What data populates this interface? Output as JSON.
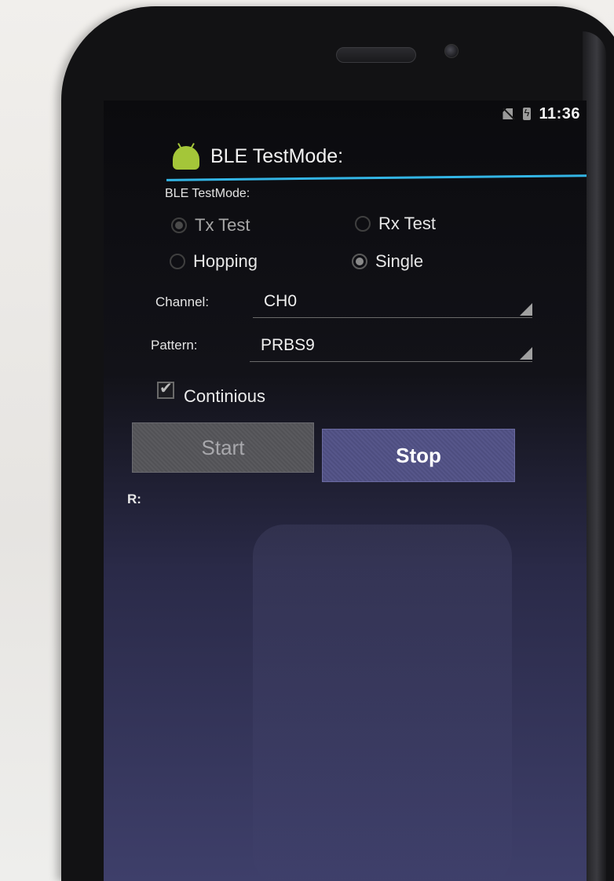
{
  "status_bar": {
    "time": "11:36",
    "no_sim_icon": "no-sim-icon",
    "battery_icon": "battery-charging-icon"
  },
  "app": {
    "title": "BLE TestMode:",
    "icon": "android-icon"
  },
  "test_mode": {
    "label": "BLE TestMode:",
    "options": [
      {
        "label": "Tx Test",
        "checked": true,
        "enabled": false
      },
      {
        "label": "Rx Test",
        "checked": false,
        "enabled": false
      },
      {
        "label": "Hopping",
        "checked": false,
        "enabled": false
      },
      {
        "label": "Single",
        "checked": true,
        "enabled": true
      }
    ]
  },
  "channel": {
    "label": "Channel:",
    "value": "CH0"
  },
  "pattern": {
    "label": "Pattern:",
    "value": "PRBS9"
  },
  "continuous": {
    "label": "Continious",
    "checked": true
  },
  "buttons": {
    "start": "Start",
    "stop": "Stop"
  },
  "result": {
    "label": "R:"
  }
}
